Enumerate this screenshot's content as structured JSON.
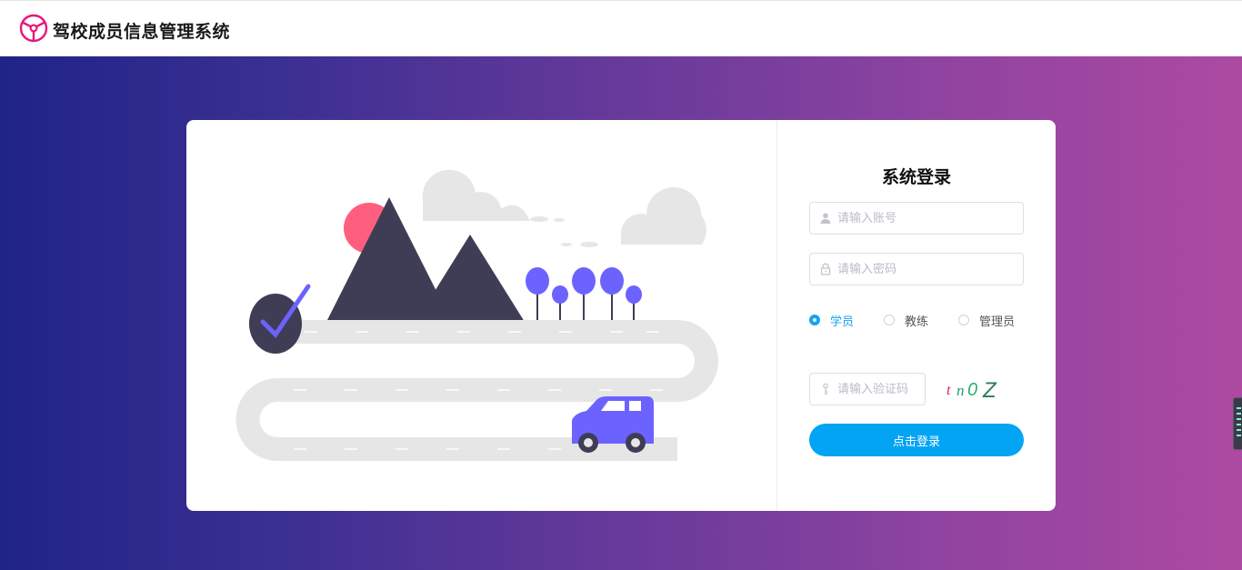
{
  "header": {
    "title": "驾校成员信息管理系统",
    "logo_icon": "steering-wheel-icon",
    "brand_color": "#e8157b"
  },
  "login": {
    "title": "系统登录",
    "account": {
      "placeholder": "请输入账号",
      "value": "",
      "icon": "user-icon"
    },
    "password": {
      "placeholder": "请输入密码",
      "value": "",
      "icon": "lock-icon"
    },
    "roles": [
      {
        "label": "学员",
        "checked": true
      },
      {
        "label": "教练",
        "checked": false
      },
      {
        "label": "管理员",
        "checked": false
      }
    ],
    "captcha": {
      "placeholder": "请输入验证码",
      "value": "",
      "icon": "key-icon",
      "code_chars": [
        "t",
        "n",
        "0",
        "Z"
      ]
    },
    "submit_label": "点击登录",
    "accent_color": "#03a4f3"
  },
  "background": {
    "gradient_start": "#1f2486",
    "gradient_end": "#ad4aa2"
  }
}
